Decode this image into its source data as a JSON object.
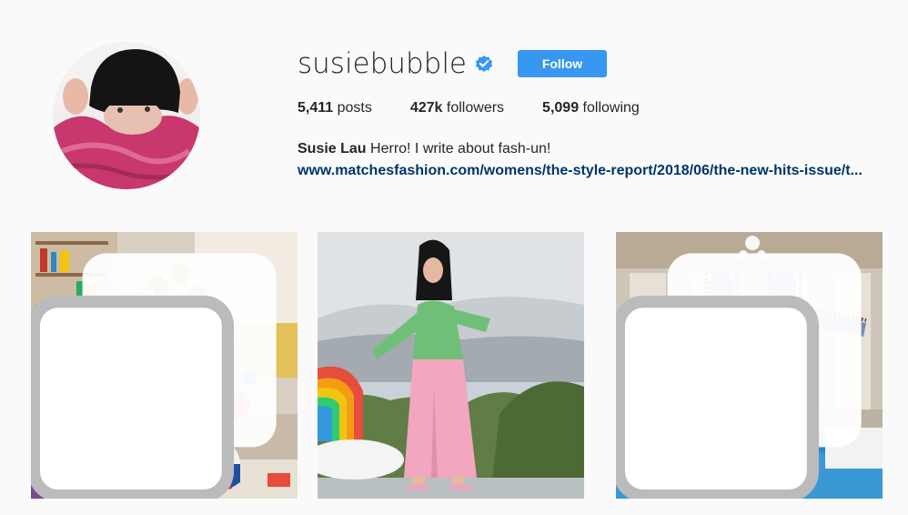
{
  "profile": {
    "username": "susiebubble",
    "verified_icon": "verified-badge-icon",
    "follow_label": "Follow",
    "accent_color": "#3897f0",
    "link_color": "#003569"
  },
  "stats": {
    "posts_count": "5,411",
    "posts_label": "posts",
    "followers_count": "427k",
    "followers_label": "followers",
    "following_count": "5,099",
    "following_label": "following"
  },
  "bio": {
    "full_name": "Susie Lau",
    "text": "Herro! I write about fash-un!",
    "link": "www.matchesfashion.com/womens/the-style-report/2018/06/the-new-hits-issue/t..."
  },
  "posts": [
    {
      "multi_icon": "multiple-images-icon"
    },
    {},
    {
      "multi_icon": "multiple-images-icon"
    }
  ]
}
